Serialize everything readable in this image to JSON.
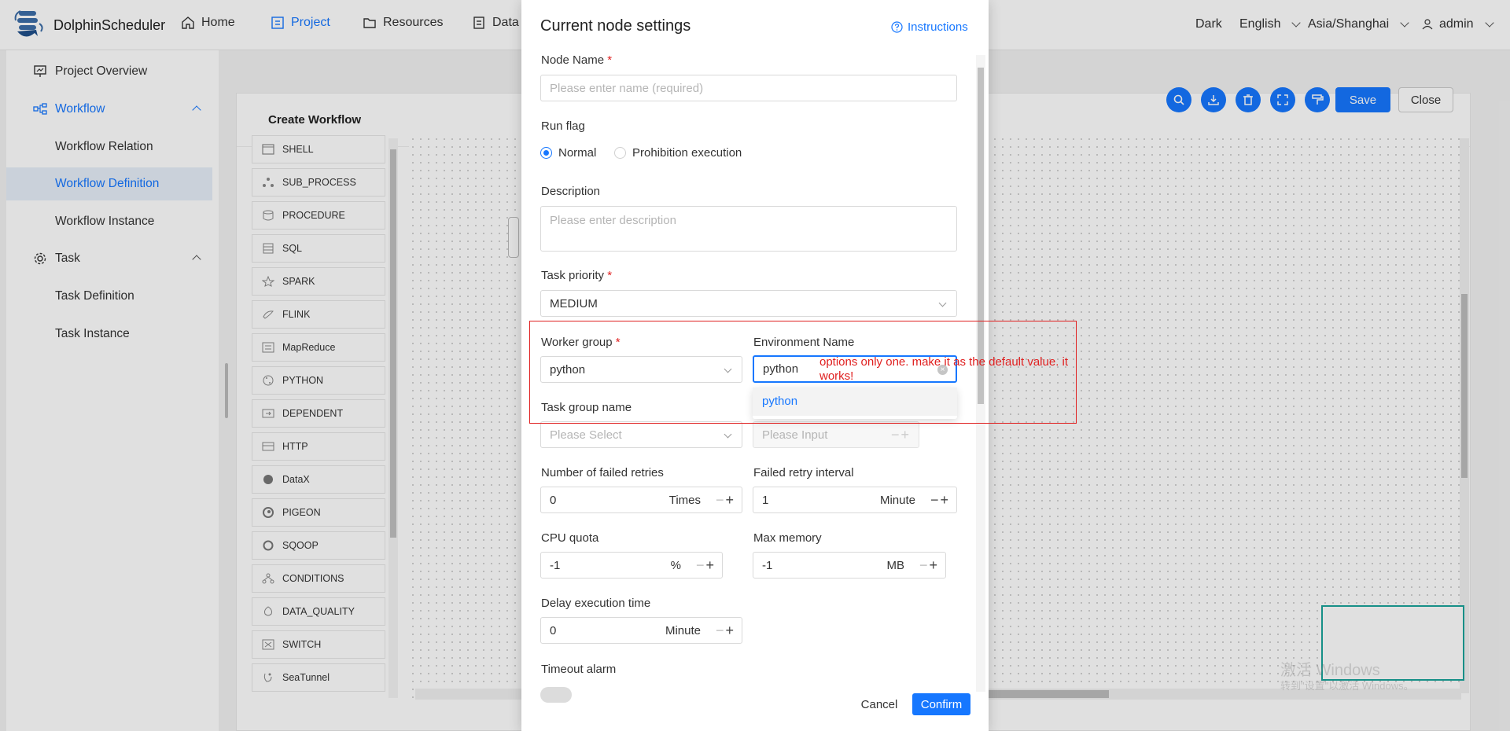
{
  "nav": {
    "logo_text": "DolphinScheduler",
    "items": [
      {
        "label": "Home",
        "icon": "home-icon"
      },
      {
        "label": "Project",
        "icon": "project-icon"
      },
      {
        "label": "Resources",
        "icon": "folder-icon"
      },
      {
        "label": "Data",
        "icon": "datasource-icon"
      }
    ],
    "theme": "Dark",
    "language": "English",
    "timezone": "Asia/Shanghai",
    "user": "admin"
  },
  "sidebar": {
    "items": [
      {
        "label": "Project Overview"
      },
      {
        "label": "Workflow"
      },
      {
        "label": "Workflow Relation"
      },
      {
        "label": "Workflow Definition"
      },
      {
        "label": "Workflow Instance"
      },
      {
        "label": "Task"
      },
      {
        "label": "Task Definition"
      },
      {
        "label": "Task Instance"
      }
    ]
  },
  "main": {
    "title": "Create Workflow",
    "save_label": "Save",
    "close_label": "Close"
  },
  "tasks": [
    "SHELL",
    "SUB_PROCESS",
    "PROCEDURE",
    "SQL",
    "SPARK",
    "FLINK",
    "MapReduce",
    "PYTHON",
    "DEPENDENT",
    "HTTP",
    "DataX",
    "PIGEON",
    "SQOOP",
    "CONDITIONS",
    "DATA_QUALITY",
    "SWITCH",
    "SeaTunnel"
  ],
  "modal": {
    "title": "Current node settings",
    "instructions": "Instructions",
    "node_name_label": "Node Name",
    "node_name_placeholder": "Please enter name (required)",
    "run_flag_label": "Run flag",
    "run_flag_normal": "Normal",
    "run_flag_prohibit": "Prohibition execution",
    "description_label": "Description",
    "description_placeholder": "Please enter description",
    "priority_label": "Task priority",
    "priority_value": "MEDIUM",
    "worker_group_label": "Worker group",
    "worker_group_value": "python",
    "env_label": "Environment Name",
    "env_value": "python",
    "env_option": "python",
    "task_group_label": "Task group name",
    "task_group_placeholder": "Please Select",
    "task_group_priority_placeholder": "Please Input",
    "retries_label": "Number of failed retries",
    "retries_value": "0",
    "retries_unit": "Times",
    "retry_interval_label": "Failed retry interval",
    "retry_interval_value": "1",
    "retry_interval_unit": "Minute",
    "cpu_label": "CPU quota",
    "cpu_value": "-1",
    "cpu_unit": "%",
    "memory_label": "Max memory",
    "memory_value": "-1",
    "memory_unit": "MB",
    "delay_label": "Delay execution time",
    "delay_value": "0",
    "delay_unit": "Minute",
    "timeout_label": "Timeout alarm",
    "cancel_label": "Cancel",
    "confirm_label": "Confirm",
    "required_mark": "*",
    "pm_minus": "−",
    "pm_plus": "+"
  },
  "annotation": {
    "text": "options only one. make it as the default value. it works!"
  },
  "watermark": {
    "line1": "激活 Windows",
    "line2": "转到\"设置\"以激活 Windows。"
  },
  "colors": {
    "accent": "#1677ff",
    "annotation": "#e02020"
  }
}
